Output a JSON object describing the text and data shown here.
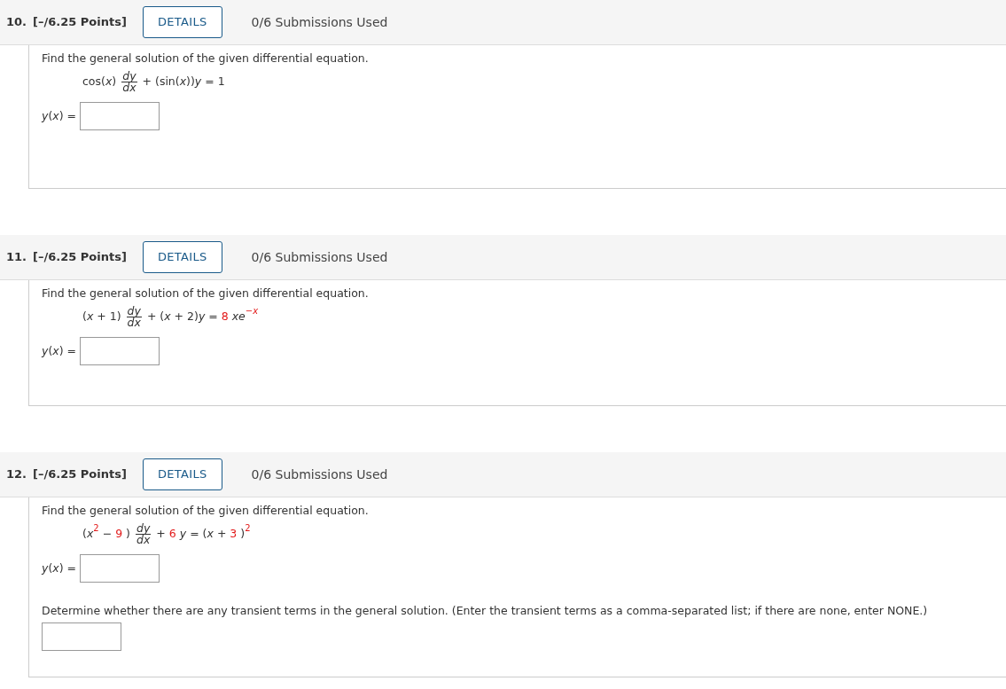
{
  "problems": [
    {
      "number": "10.",
      "points": "[–/6.25 Points]",
      "details_button": "DETAILS",
      "submissions": "0/6 Submissions Used",
      "items": [
        {
          "kind": "prompt",
          "text": "Find the general solution of the given differential equation."
        },
        {
          "kind": "equation",
          "tokens": [
            {
              "kind": "text",
              "text": "cos(*x*)",
              "highlighted": false
            },
            {
              "kind": "fraction",
              "numerator": "*dy*",
              "denominator": "*dx*"
            },
            {
              "kind": "text",
              "text": "+ (sin(*x*))*y* = 1",
              "highlighted": false
            }
          ]
        },
        {
          "kind": "answer",
          "label": "*y*(*x*) ="
        }
      ]
    },
    {
      "number": "11.",
      "points": "[–/6.25 Points]",
      "details_button": "DETAILS",
      "submissions": "0/6 Submissions Used",
      "items": [
        {
          "kind": "prompt",
          "text": "Find the general solution of the given differential equation."
        },
        {
          "kind": "equation",
          "tokens": [
            {
              "kind": "text",
              "text": "(*x* + 1)",
              "highlighted": false
            },
            {
              "kind": "fraction",
              "numerator": "*dy*",
              "denominator": "*dx*"
            },
            {
              "kind": "text",
              "text": "+ (*x* + 2)*y* =",
              "highlighted": false
            },
            {
              "kind": "text",
              "text": "8",
              "highlighted": true
            },
            {
              "kind": "text",
              "text": "*xe*",
              "highlighted": false
            },
            {
              "kind": "sup",
              "text": "−*x*",
              "highlighted": true
            }
          ]
        },
        {
          "kind": "answer",
          "label": "*y*(*x*) ="
        }
      ]
    },
    {
      "number": "12.",
      "points": "[–/6.25 Points]",
      "details_button": "DETAILS",
      "submissions": "0/6 Submissions Used",
      "items": [
        {
          "kind": "prompt",
          "text": "Find the general solution of the given differential equation."
        },
        {
          "kind": "equation",
          "tokens": [
            {
              "kind": "text",
              "text": "(*x*",
              "highlighted": false
            },
            {
              "kind": "sup",
              "text": "2",
              "highlighted": true
            },
            {
              "kind": "text",
              "text": "−",
              "highlighted": false
            },
            {
              "kind": "text",
              "text": "9",
              "highlighted": true
            },
            {
              "kind": "text",
              "text": ")",
              "highlighted": false
            },
            {
              "kind": "fraction",
              "numerator": "*dy*",
              "denominator": "*dx*"
            },
            {
              "kind": "text",
              "text": "+",
              "highlighted": false
            },
            {
              "kind": "text",
              "text": "6",
              "highlighted": true
            },
            {
              "kind": "text",
              "text": "*y* = (*x* +",
              "highlighted": false
            },
            {
              "kind": "text",
              "text": "3",
              "highlighted": true
            },
            {
              "kind": "text",
              "text": ")",
              "highlighted": false
            },
            {
              "kind": "sup",
              "text": "2",
              "highlighted": true
            }
          ]
        },
        {
          "kind": "answer",
          "label": "*y*(*x*) ="
        },
        {
          "kind": "question",
          "text": "Determine whether there are any transient terms in the general solution. (Enter the transient terms as a comma-separated list; if there are none, enter NONE.)"
        },
        {
          "kind": "blank"
        }
      ]
    }
  ]
}
